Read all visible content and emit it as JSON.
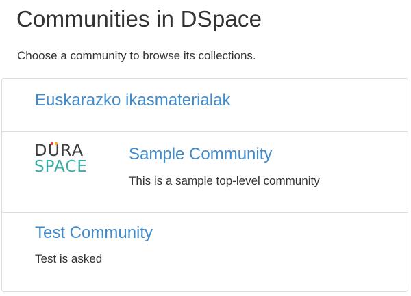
{
  "page": {
    "title": "Communities in DSpace",
    "intro": "Choose a community to browse its collections."
  },
  "communities": [
    {
      "name": "Euskarazko ikasmaterialak",
      "description": ""
    },
    {
      "name": "Sample Community",
      "description": "This is a sample top-level community",
      "logo": {
        "line1": "DURA",
        "line2": "SPACE",
        "colors": [
          "#e8453c",
          "#f7a823",
          "#3aaea6",
          "#3d3d3d"
        ]
      }
    },
    {
      "name": "Test Community",
      "description": "Test is asked"
    }
  ],
  "colors": {
    "link": "#428bca",
    "text": "#333333",
    "border": "#dddddd"
  }
}
